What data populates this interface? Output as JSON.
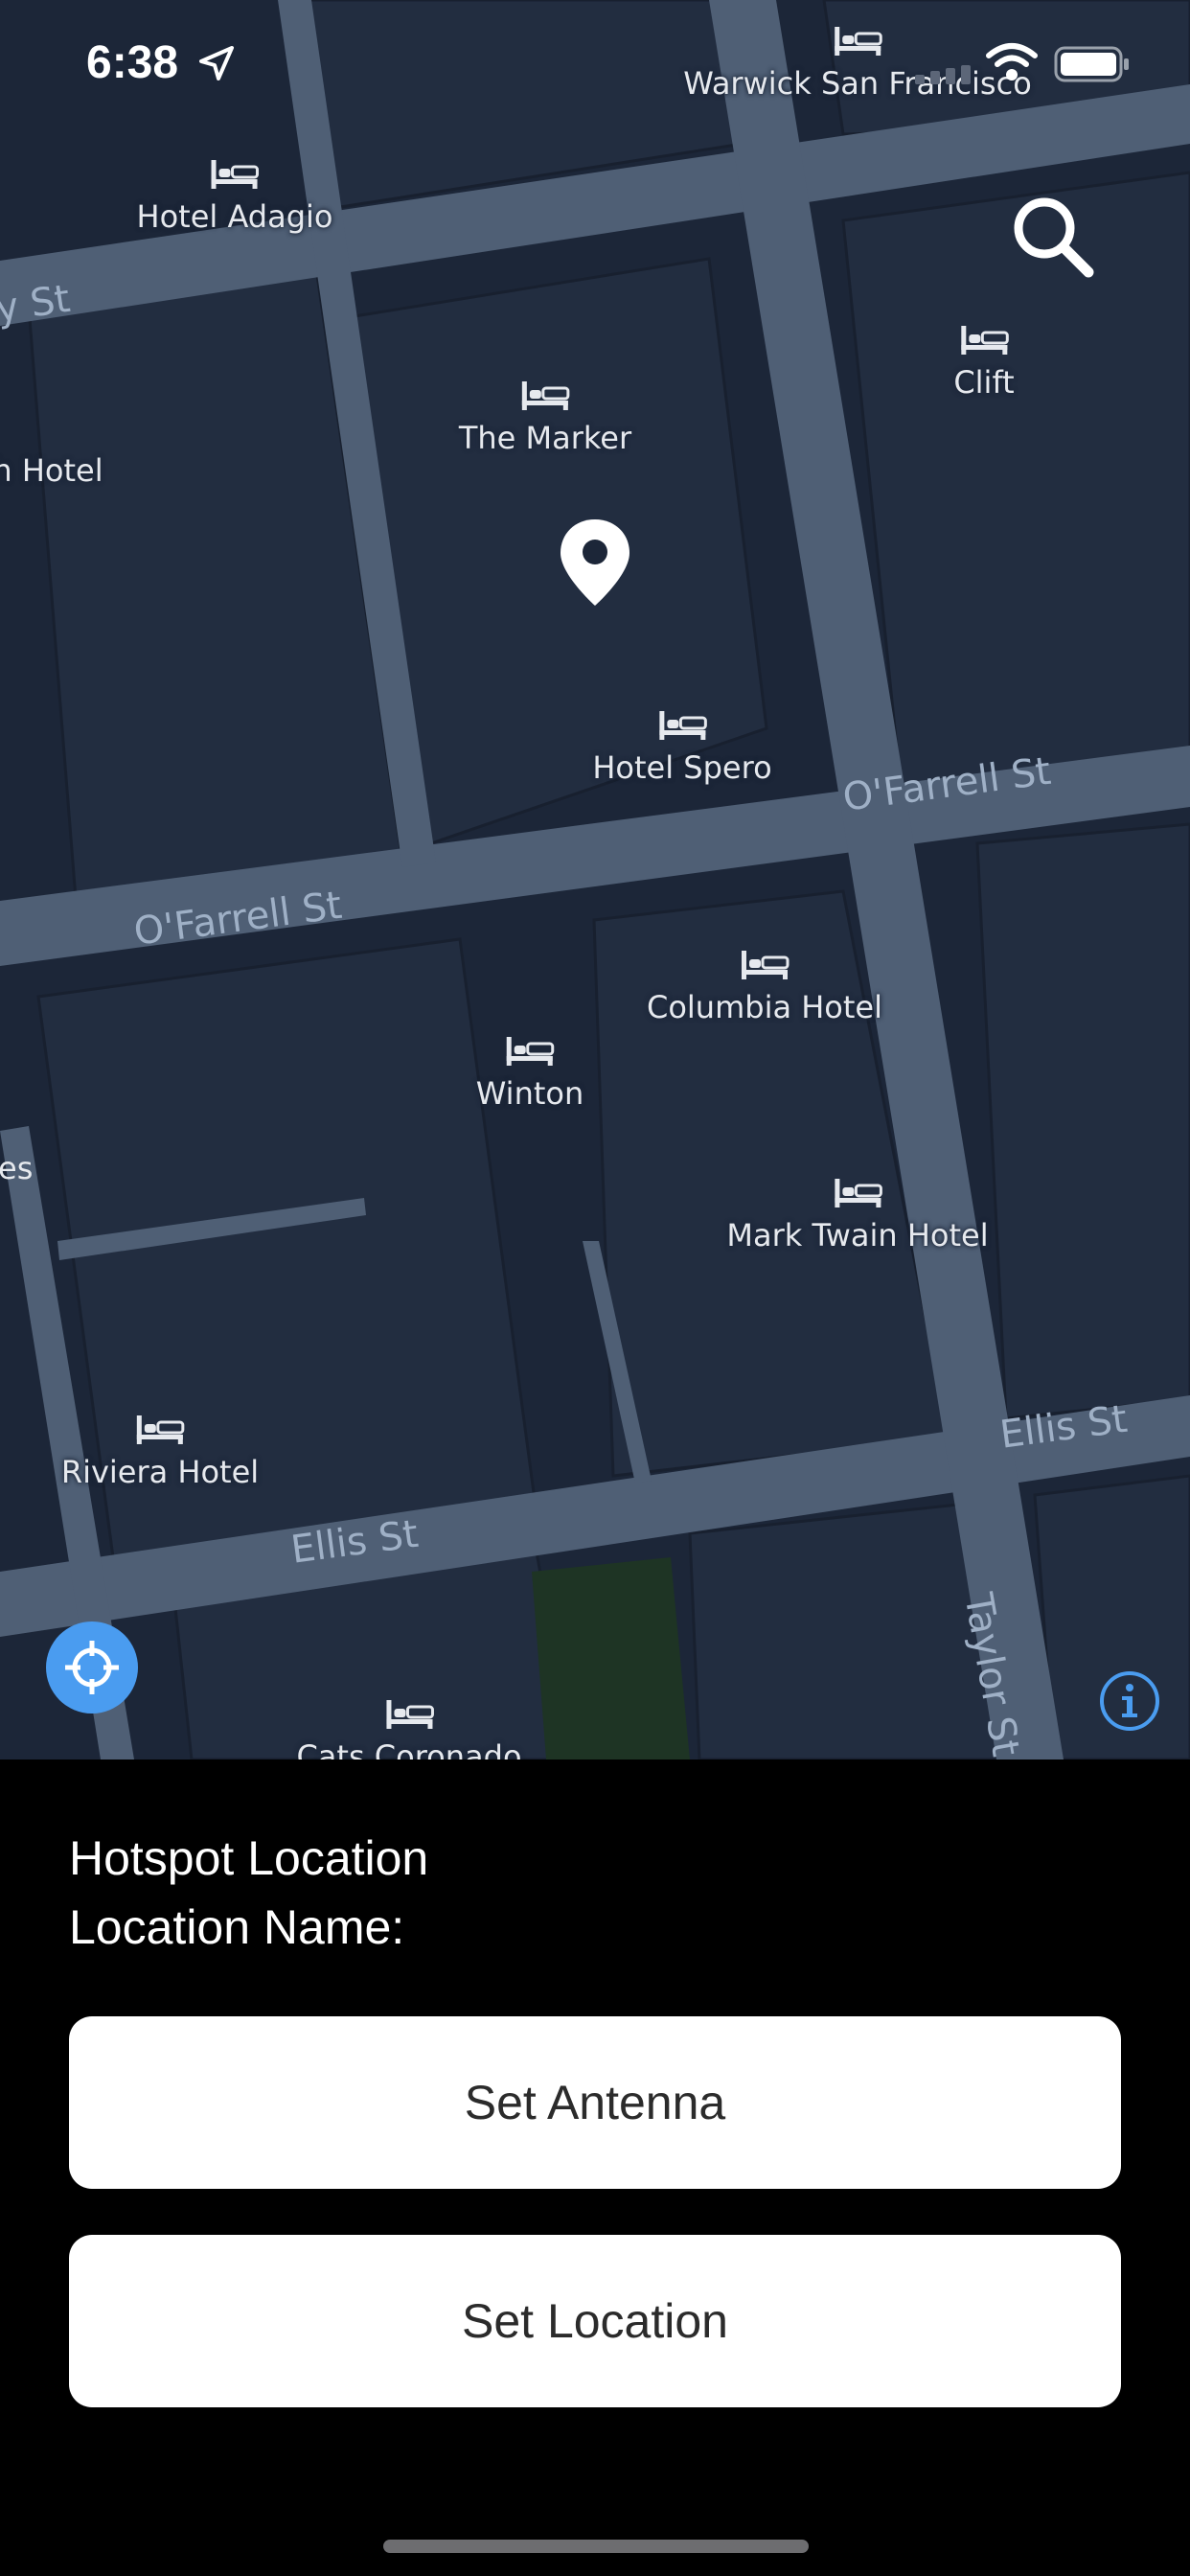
{
  "status_bar": {
    "time": "6:38",
    "icons": [
      "location-arrow-icon",
      "cellular-signal-icon",
      "wifi-icon",
      "battery-icon"
    ]
  },
  "map": {
    "icons": [
      "search-icon",
      "bed-icon",
      "map-pin-icon",
      "crosshair-icon",
      "info-icon"
    ],
    "pois": [
      "Warwick San Francisco",
      "Hotel Adagio",
      "Clift",
      "The Marker",
      "h Hotel",
      "Hotel Spero",
      "Columbia Hotel",
      "Winton",
      "Mark Twain Hotel",
      "Riviera Hotel",
      "Cats Coronado"
    ],
    "streets": [
      "y St",
      "O'Farrell St",
      "O'Farrell St",
      "Ellis St",
      "Ellis St",
      "Taylor St",
      "es"
    ]
  },
  "panel": {
    "title": "Hotspot Location",
    "location_label": "Location Name:",
    "set_antenna": "Set Antenna",
    "set_location": "Set Location"
  },
  "colors": {
    "map_background": "#1c2638",
    "road": "#4f5f75",
    "accent_blue": "#4a9cf0",
    "button_background": "#ffffff",
    "panel_background": "#000000"
  }
}
